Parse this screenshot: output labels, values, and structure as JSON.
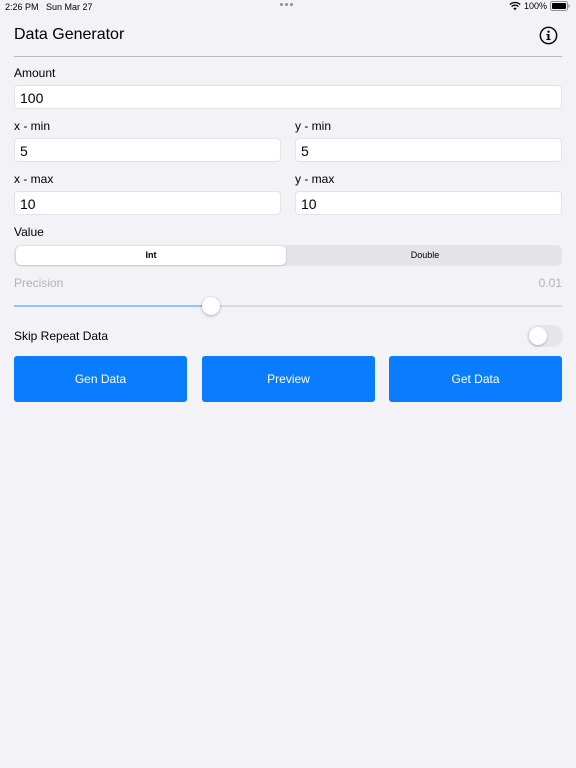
{
  "status_bar": {
    "time": "2:26 PM",
    "date": "Sun Mar 27",
    "battery": "100%",
    "icons": [
      "wifi-icon",
      "battery-icon"
    ]
  },
  "nav": {
    "title": "Data Generator",
    "info_icon": "info-circle-icon"
  },
  "form": {
    "amount_label": "Amount",
    "amount_value": "100",
    "xmin_label": "x - min",
    "xmin_value": "5",
    "ymin_label": "y - min",
    "ymin_value": "5",
    "xmax_label": "x - max",
    "xmax_value": "10",
    "ymax_label": "y - max",
    "ymax_value": "10",
    "value_label": "Value",
    "value_options": [
      "Int",
      "Double"
    ],
    "value_selected": "Int",
    "precision_label": "Precision",
    "precision_value": "0.01",
    "precision_slider_fraction": 0.36,
    "skip_label": "Skip Repeat Data",
    "skip_enabled": false
  },
  "actions": {
    "gen_label": "Gen Data",
    "preview_label": "Preview",
    "get_label": "Get Data"
  },
  "colors": {
    "accent": "#0a7cff",
    "background": "#f2f2f7",
    "disabled_text": "#b3b3b8"
  }
}
